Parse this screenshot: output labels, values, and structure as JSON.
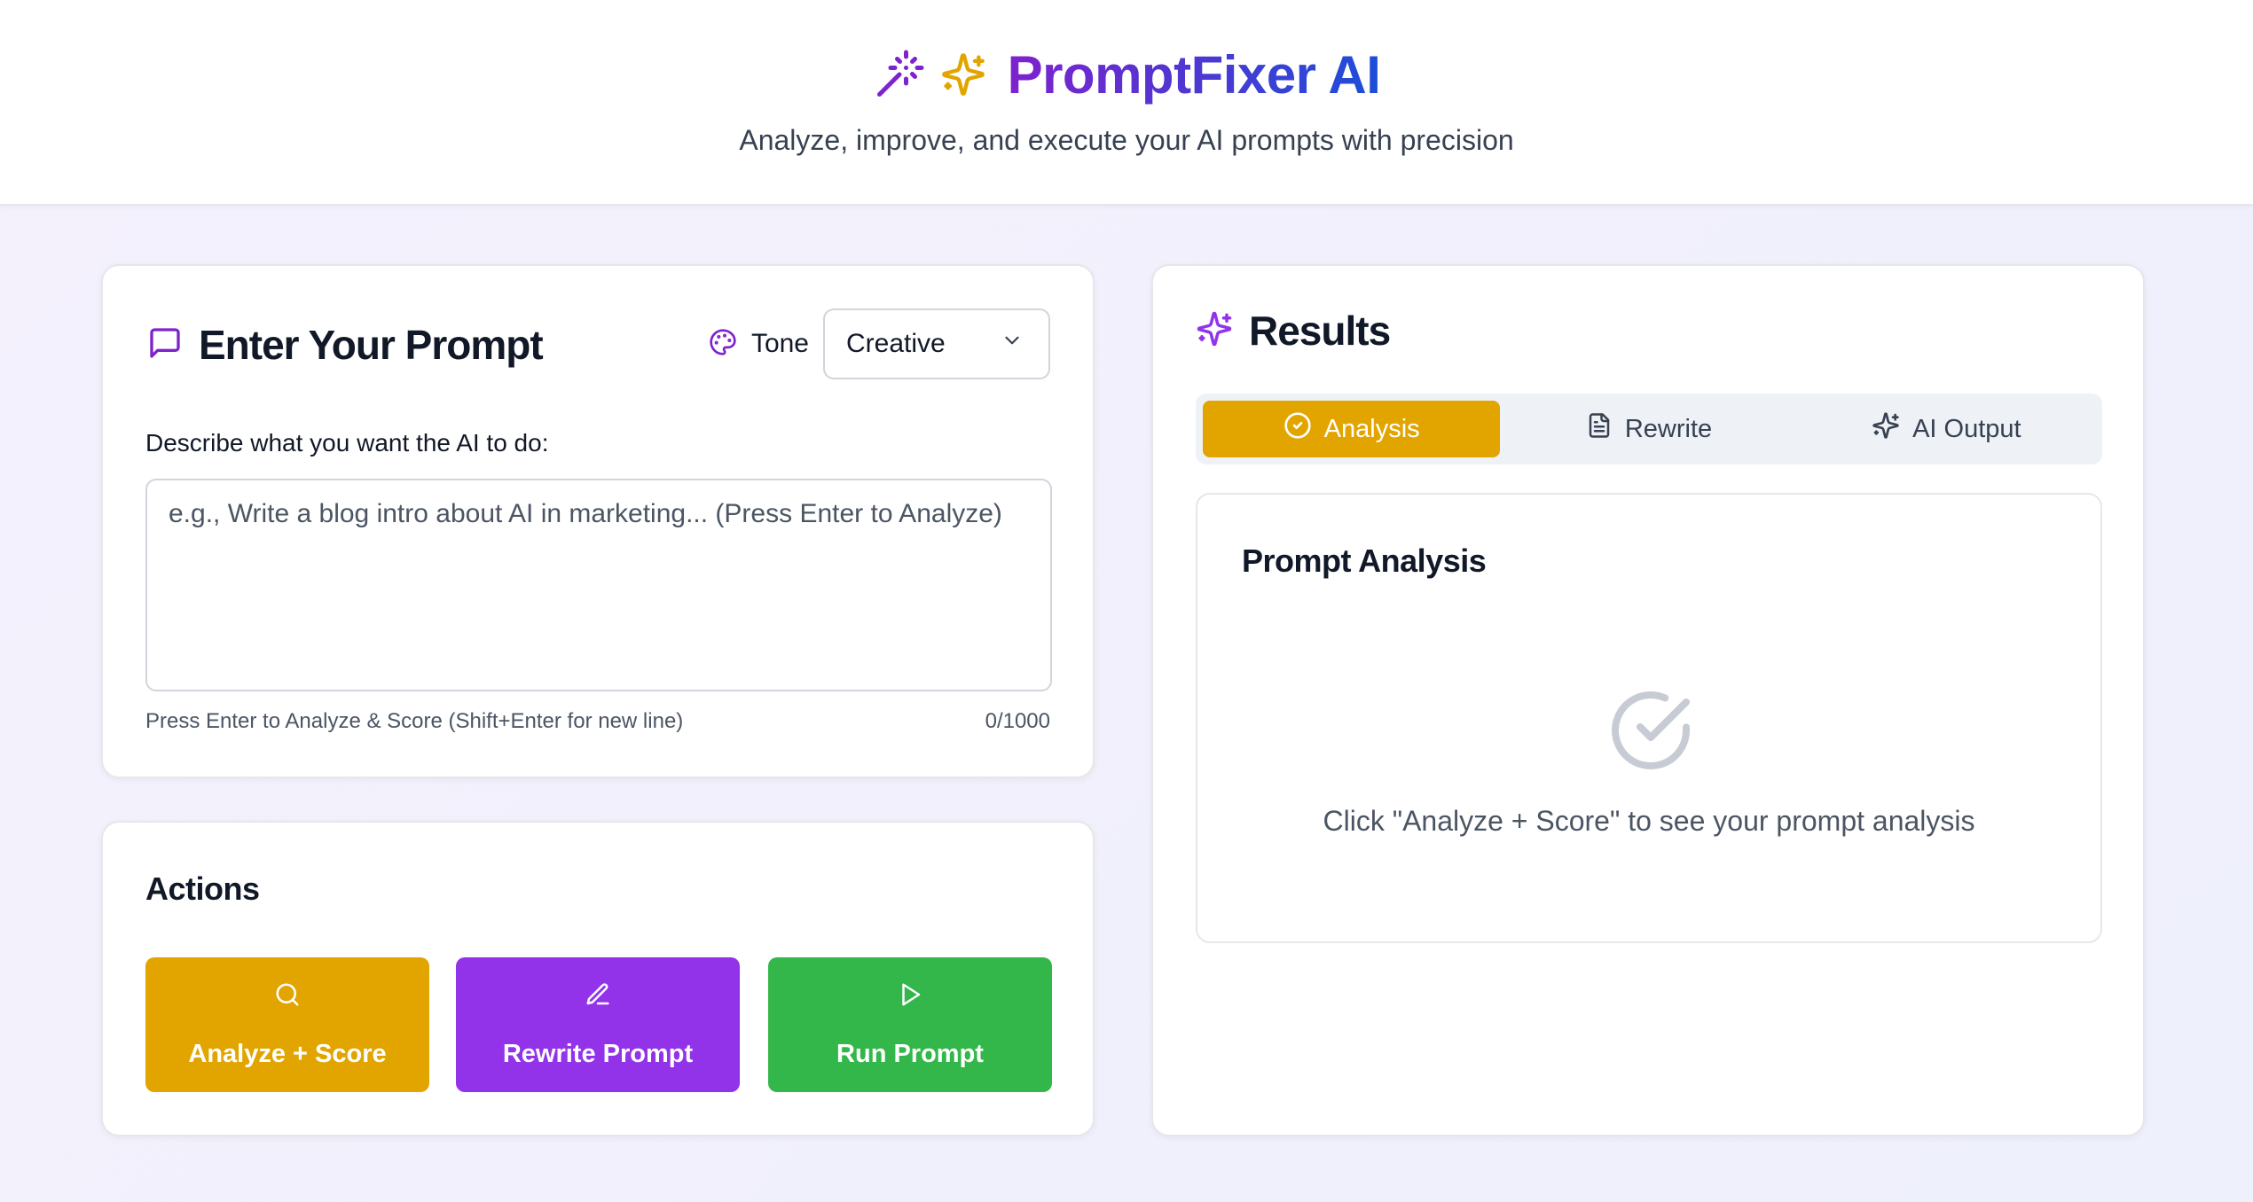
{
  "app": {
    "title": "PromptFixer AI",
    "subtitle": "Analyze, improve, and execute your AI prompts with precision"
  },
  "prompt_card": {
    "title": "Enter Your Prompt",
    "tone_label": "Tone",
    "tone_value": "Creative",
    "field_label": "Describe what you want the AI to do:",
    "textarea_value": "",
    "textarea_placeholder": "e.g., Write a blog intro about AI in marketing... (Press Enter to Analyze)",
    "hint": "Press Enter to Analyze & Score (Shift+Enter for new line)",
    "char_counter": "0/1000"
  },
  "actions_card": {
    "title": "Actions",
    "buttons": [
      {
        "label": "Analyze + Score",
        "icon": "search-icon",
        "color": "#e2a500"
      },
      {
        "label": "Rewrite Prompt",
        "icon": "pencil-icon",
        "color": "#9233ea"
      },
      {
        "label": "Run Prompt",
        "icon": "play-icon",
        "color": "#34b74a"
      }
    ]
  },
  "results_card": {
    "title": "Results",
    "tabs": [
      {
        "label": "Analysis",
        "icon": "check-circle-icon",
        "active": true
      },
      {
        "label": "Rewrite",
        "icon": "document-icon",
        "active": false
      },
      {
        "label": "AI Output",
        "icon": "sparkles-icon",
        "active": false
      }
    ],
    "panel_title": "Prompt Analysis",
    "empty_message": "Click \"Analyze + Score\" to see your prompt analysis"
  },
  "colors": {
    "accent_amber": "#e2a500",
    "accent_purple": "#9233ea",
    "accent_green": "#34b74a",
    "brand_gradient_start": "#7e22ce",
    "brand_gradient_end": "#1d4ed8"
  }
}
